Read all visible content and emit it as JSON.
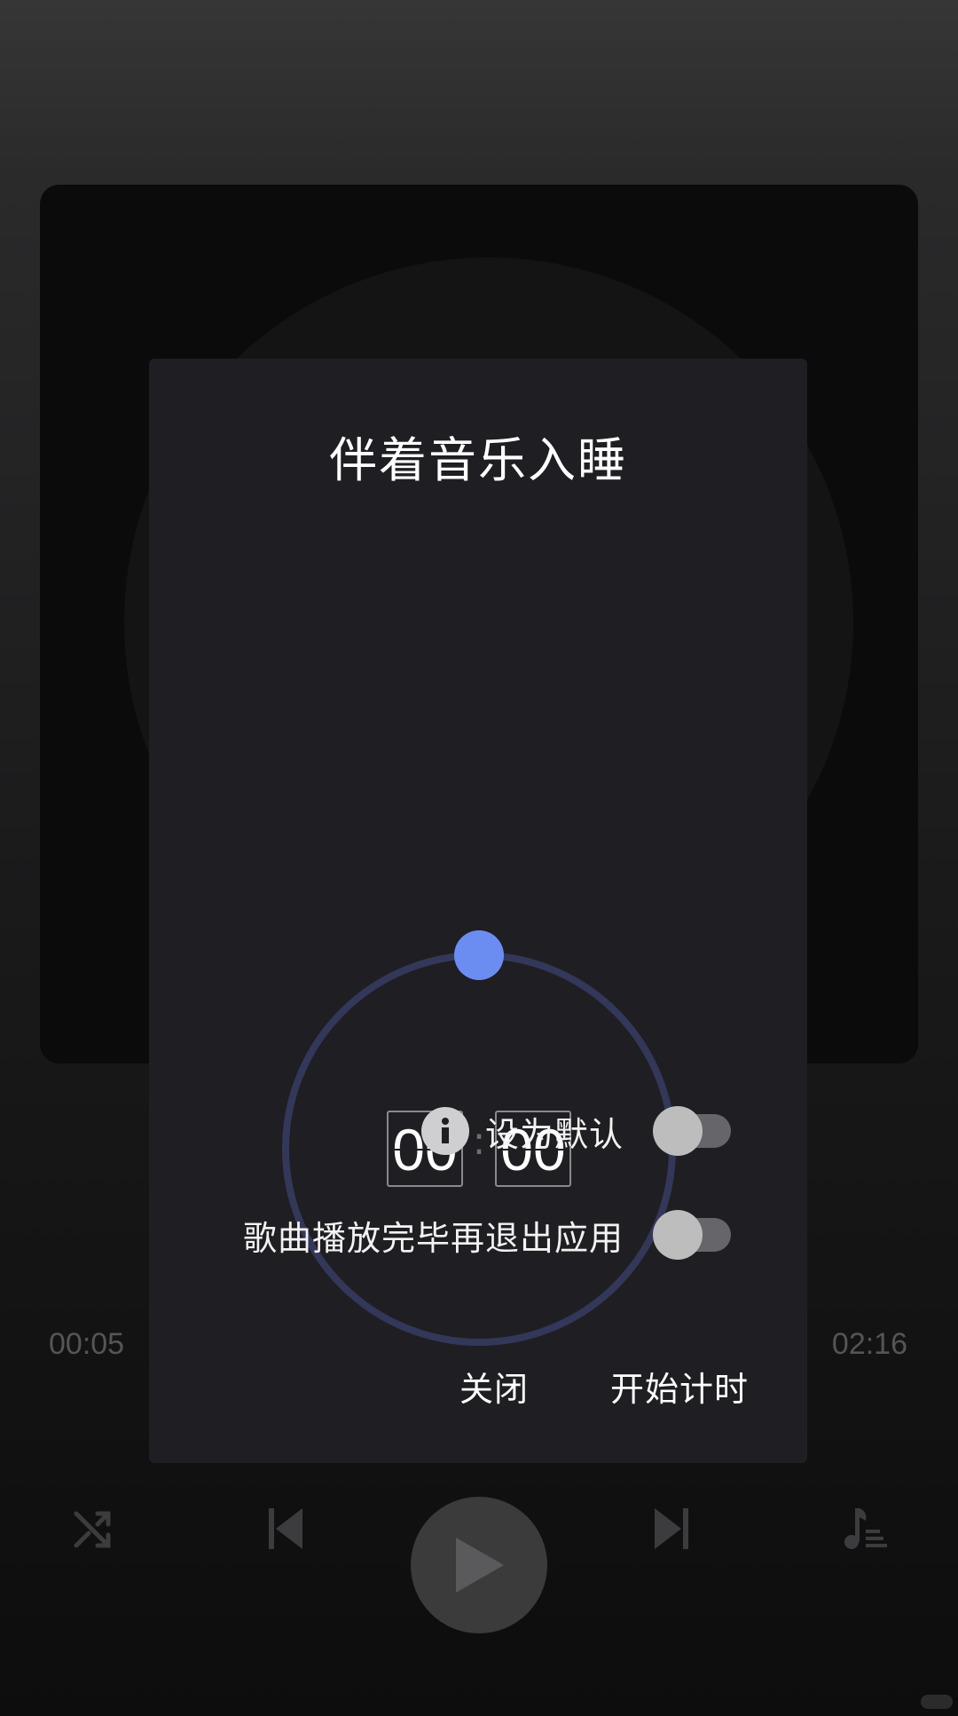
{
  "player": {
    "current_time": "00:05",
    "total_time": "02:16",
    "controls": [
      "shuffle",
      "previous",
      "play",
      "next",
      "playlist"
    ]
  },
  "dialog": {
    "title": "伴着音乐入睡",
    "timer": {
      "minutes": "00",
      "seconds": "00",
      "separator": ":",
      "progress_fraction": 0
    },
    "options": [
      {
        "label": "设为默认",
        "icon": "info-icon",
        "enabled": false
      },
      {
        "label": "歌曲播放完毕再退出应用",
        "enabled": false
      }
    ],
    "buttons": {
      "close": "关闭",
      "start": "开始计时"
    }
  },
  "colors": {
    "accent": "#6b8df2",
    "dial_ring": "#33385a",
    "dialog_bg": "#1f1e22"
  }
}
